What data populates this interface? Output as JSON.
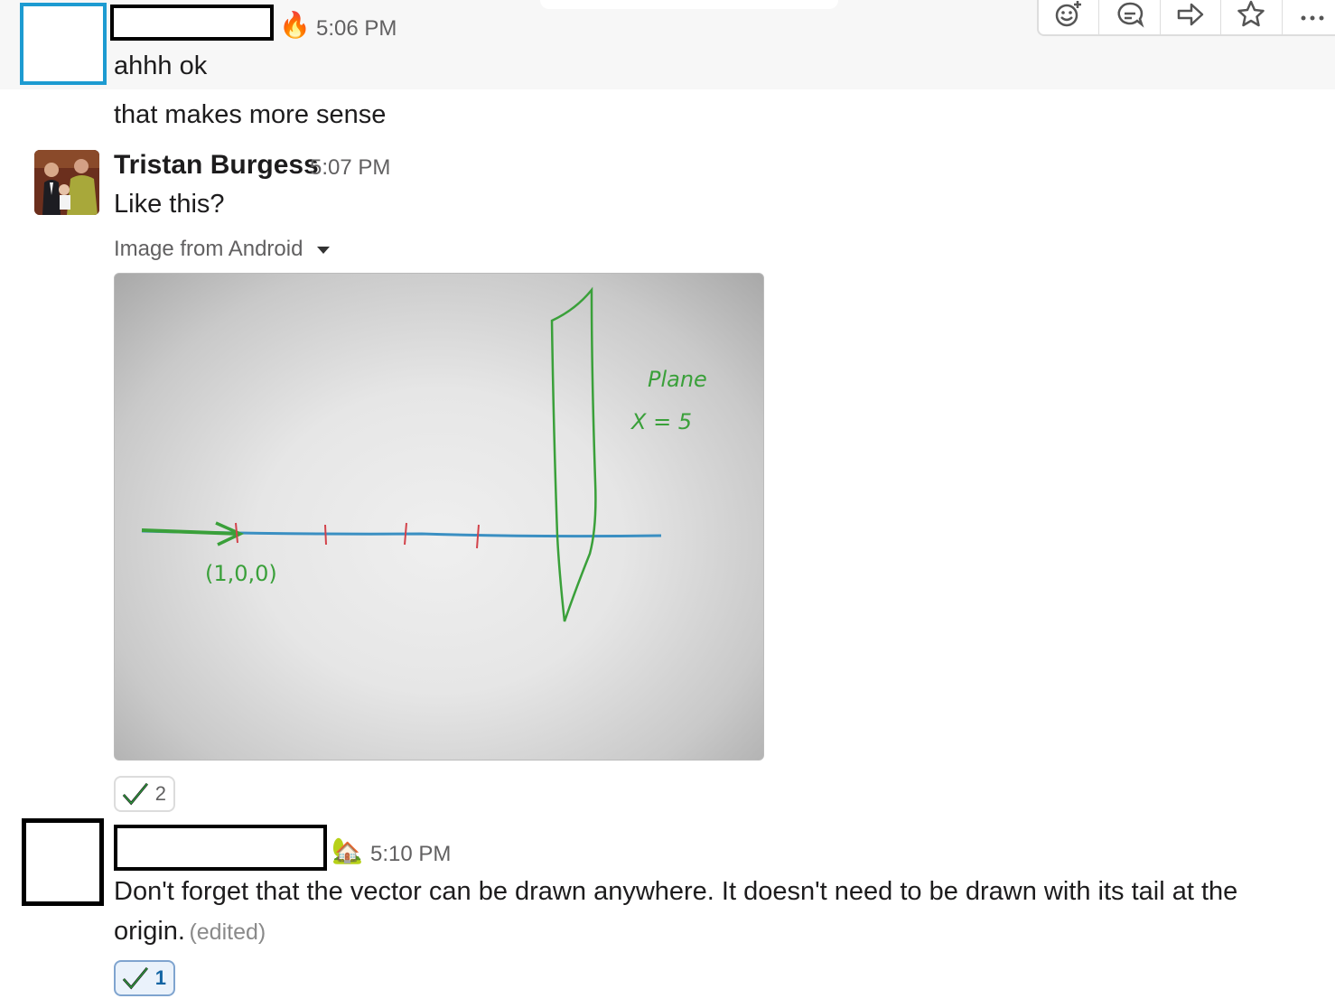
{
  "messages": {
    "m1": {
      "emoji": "🔥",
      "time": "5:06 PM",
      "line1": "ahhh ok",
      "line2": "that makes more sense"
    },
    "m2": {
      "author": "Tristan Burgess",
      "time": "5:07 PM",
      "text": "Like this?",
      "file_label": "Image from Android",
      "reaction_count": "2"
    },
    "m3": {
      "emoji": "🏡",
      "time": "5:10 PM",
      "text_line1": "Don't forget that the vector can be drawn anywhere.  It doesn't need to be drawn with its tail at the",
      "text_line2": "origin.",
      "edited": "(edited)",
      "reaction_count": "1"
    }
  },
  "sketch": {
    "point_label": "(1,0,0)",
    "plane_label_1": "Plane",
    "plane_label_2": "X = 5"
  },
  "toolbar": {
    "icons": [
      "add-reaction-icon",
      "start-thread-icon",
      "share-message-icon",
      "save-star-icon",
      "more-actions-icon"
    ]
  },
  "colors": {
    "accent_blue": "#1d9bd1",
    "link_blue": "#1264a3",
    "hover_bg": "#f7f7f7",
    "ink_green": "#3aa03a",
    "ink_blue": "#3a8fc2",
    "ink_red": "#d2424a"
  }
}
